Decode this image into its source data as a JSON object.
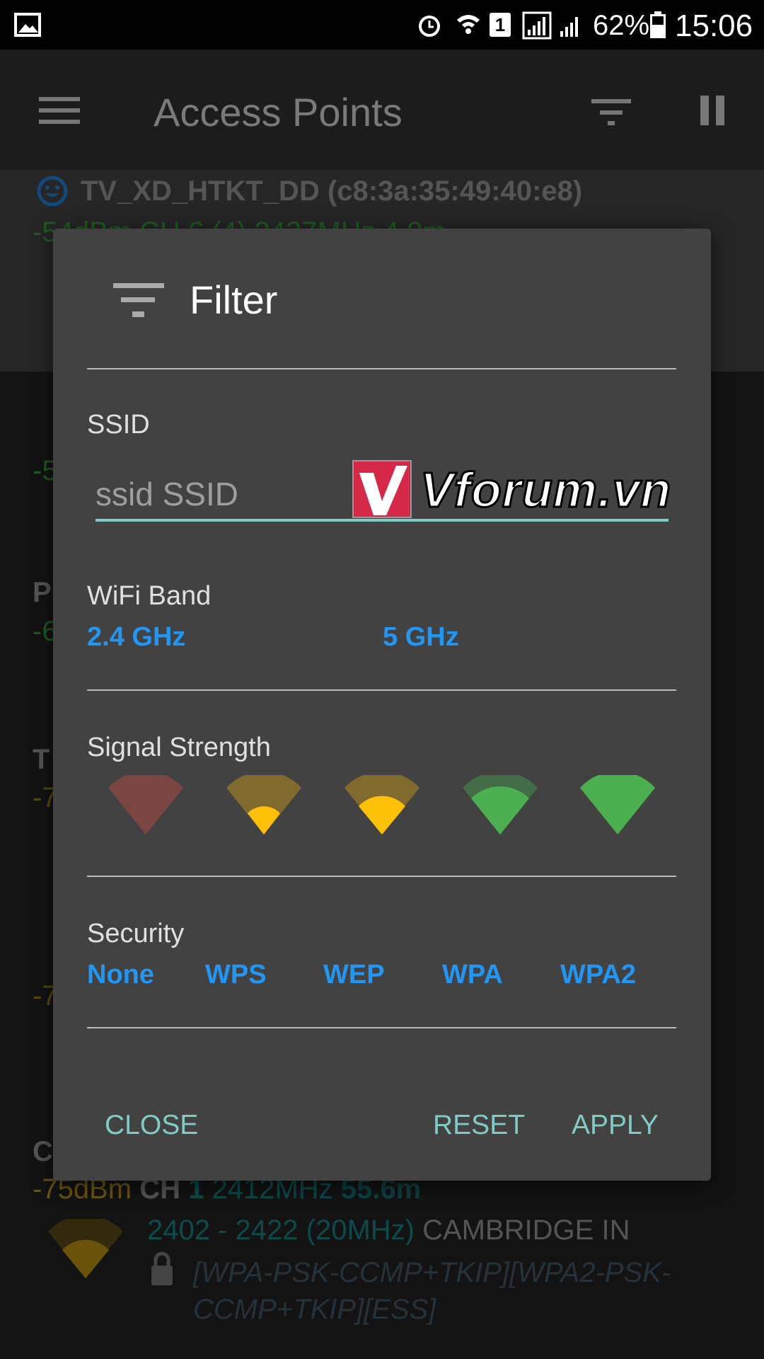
{
  "status_bar": {
    "battery": "62%",
    "time": "15:06",
    "sim": "1",
    "icons": [
      "image-icon",
      "alarm-icon",
      "wifi-icon",
      "sim-icon",
      "signal-icon",
      "battery-icon"
    ]
  },
  "app_bar": {
    "title": "Access Points",
    "icons": [
      "menu-icon",
      "filter-icon",
      "pause-icon"
    ]
  },
  "background_list": {
    "first": {
      "ssid": "TV_XD_HTKT_DD (c8:3a:35:49:40:e8)",
      "detail": "-54dBm CH 6 (4) 2437MHz 4.0m"
    },
    "partial_letters": [
      "P",
      "T",
      "C"
    ],
    "partial_levels": [
      "-5",
      "-6",
      "-7",
      "-7"
    ],
    "last": {
      "level": "-75dBm",
      "ch_label": "CH",
      "channel": "1",
      "freq": "2412MHz",
      "distance": "55.6m",
      "range": "2402 - 2422 (20MHz)",
      "vendor": "CAMBRIDGE IN",
      "capabilities": "[WPA-PSK-CCMP+TKIP][WPA2-PSK-CCMP+TKIP][ESS]"
    }
  },
  "dialog": {
    "title": "Filter",
    "ssid": {
      "label": "SSID",
      "placeholder": "ssid SSID",
      "value": ""
    },
    "wifi_band": {
      "label": "WiFi Band",
      "options": [
        "2.4 GHz",
        "5 GHz"
      ]
    },
    "signal_strength": {
      "label": "Signal Strength",
      "levels": [
        0,
        1,
        2,
        3,
        4
      ]
    },
    "security": {
      "label": "Security",
      "options": [
        "None",
        "WPS",
        "WEP",
        "WPA",
        "WPA2"
      ]
    },
    "buttons": {
      "close": "CLOSE",
      "reset": "RESET",
      "apply": "APPLY"
    }
  },
  "watermark": "Vforum.vn",
  "colors": {
    "accent": "#80cbc4",
    "option": "#2196f3",
    "dialog_bg": "#424242",
    "green": "#4caf50",
    "yellow": "#ffc107",
    "red": "#f44336"
  }
}
